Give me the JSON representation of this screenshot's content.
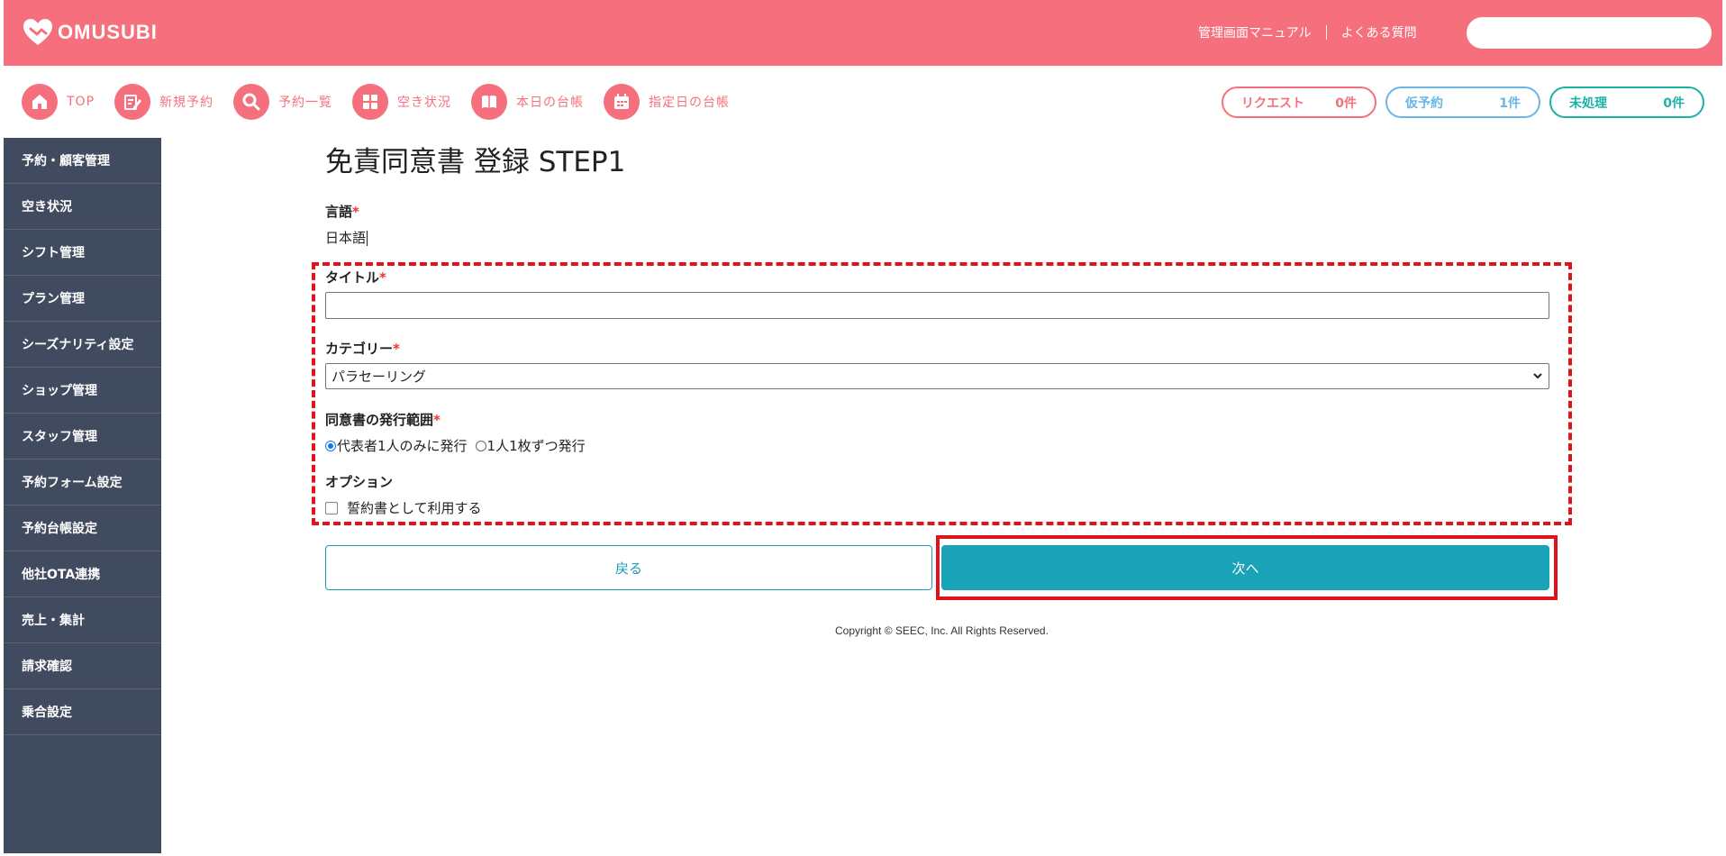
{
  "header": {
    "logo_text": "OMUSUBI",
    "links": [
      "管理画面マニュアル",
      "よくある質問"
    ],
    "search_placeholder": ""
  },
  "quick_nav": [
    {
      "label": "TOP",
      "icon": "home-icon"
    },
    {
      "label": "新規予約",
      "icon": "edit-icon"
    },
    {
      "label": "予約一覧",
      "icon": "search-icon"
    },
    {
      "label": "空き状況",
      "icon": "grid-icon"
    },
    {
      "label": "本日の台帳",
      "icon": "book-icon"
    },
    {
      "label": "指定日の台帳",
      "icon": "calendar-icon"
    }
  ],
  "status_pills": {
    "request": {
      "label": "リクエスト",
      "count": "0件",
      "color": "#f5707c"
    },
    "temp": {
      "label": "仮予約",
      "count": "1件",
      "color": "#6ab6e6"
    },
    "pending": {
      "label": "未処理",
      "count": "0件",
      "color": "#1bb2a6"
    }
  },
  "sidebar": {
    "items": [
      "予約・顧客管理",
      "空き状況",
      "シフト管理",
      "プラン管理",
      "シーズナリティ設定",
      "ショップ管理",
      "スタッフ管理",
      "予約フォーム設定",
      "予約台帳設定",
      "他社OTA連携",
      "売上・集計",
      "請求確認",
      "乗合設定"
    ]
  },
  "form": {
    "page_title": "免責同意書 登録 STEP1",
    "language_label": "言語",
    "language_value": "日本語",
    "title_label": "タイトル",
    "title_value": "",
    "category_label": "カテゴリー",
    "category_value": "パラセーリング",
    "issue_label": "同意書の発行範囲",
    "issue_options": [
      "代表者1人のみに発行",
      "1人1枚ずつ発行"
    ],
    "issue_selected": 0,
    "option_label": "オプション",
    "option_checkbox_label": "誓約書として利用する",
    "required_mark": "*",
    "back_label": "戻る",
    "next_label": "次へ"
  },
  "footer": {
    "copyright": "Copyright © SEEC, Inc. All Rights Reserved."
  },
  "colors": {
    "brand": "#f5707c",
    "sidebar": "#414b5f",
    "primary_button": "#1aa2b8",
    "highlight": "#e0121b"
  }
}
